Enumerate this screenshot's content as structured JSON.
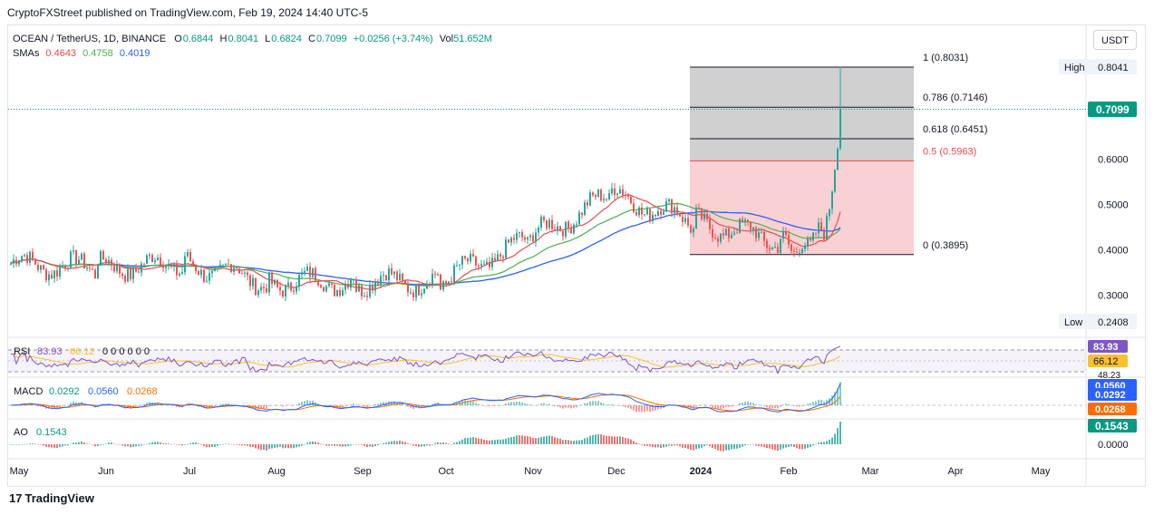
{
  "publisher": "CryptoFXStreet published on TradingView.com, Feb 19, 2024 14:40 UTC-5",
  "currency_button": "USDT",
  "legend": {
    "symbol": "OCEAN / TetherUS, 1D, BINANCE",
    "o_label": "O",
    "o": "0.6844",
    "h_label": "H",
    "h": "0.8041",
    "l_label": "L",
    "l": "0.6824",
    "c_label": "C",
    "c": "0.7099",
    "change": "+0.0256 (+3.74%)",
    "vol_label": "Vol",
    "vol": "51.652M",
    "smas_label": "SMAs",
    "sma1": "0.4643",
    "sma2": "0.4758",
    "sma3": "0.4019"
  },
  "price_axis": {
    "ticks": [
      "0.6000",
      "0.5000",
      "0.4000",
      "0.3000"
    ],
    "high_label": "High",
    "high_value": "0.8041",
    "low_label": "Low",
    "low_value": "0.2408",
    "last_price": "0.7099"
  },
  "fib_labels": [
    "1 (0.8031)",
    "0.786 (0.7146)",
    "0.618 (0.6451)",
    "0.5 (0.5963)",
    "0 (0.3895)"
  ],
  "x_ticks": [
    "May",
    "Jun",
    "Jul",
    "Aug",
    "Sep",
    "Oct",
    "Nov",
    "Dec",
    "2024",
    "Feb",
    "Mar",
    "Apr",
    "May"
  ],
  "rsi": {
    "label": "RSI",
    "v1": "83.93",
    "v2": "66.12",
    "dots": "0 0 0 0 0 0",
    "axis_values": [
      "83.93",
      "66.12",
      "48.23"
    ]
  },
  "macd": {
    "label": "MACD",
    "v1": "0.0292",
    "v2": "0.0560",
    "v3": "0.0268",
    "axis_values": [
      "0.0560",
      "0.0292",
      "0.0268"
    ]
  },
  "ao": {
    "label": "AO",
    "v1": "0.1543",
    "axis_values": [
      "0.1543",
      "0.0000"
    ]
  },
  "footer": {
    "logo": "17",
    "brand": "TradingView"
  },
  "colors": {
    "sma1": "#e84c4c",
    "sma2": "#4caf50",
    "sma3": "#2962ff",
    "up": "#26a69a",
    "down": "#ef5350",
    "rsi": "#7e57c2",
    "rsi_ma": "#fbc02d",
    "macd": "#2962ff",
    "signal": "#ff6d00",
    "fib_upper": "#c8c8c8",
    "fib_lower": "#f8c9cc"
  },
  "chart_data": {
    "type": "candlestick",
    "title": "OCEAN / TetherUS, 1D, BINANCE",
    "ylim": [
      0.24,
      0.85
    ],
    "grid": false,
    "monthly_closes": [
      {
        "x": "May",
        "y": 0.37
      },
      {
        "x": "Jun",
        "y": 0.36
      },
      {
        "x": "Jul",
        "y": 0.37
      },
      {
        "x": "Aug",
        "y": 0.33
      },
      {
        "x": "Sep",
        "y": 0.33
      },
      {
        "x": "Oct",
        "y": 0.33
      },
      {
        "x": "Nov",
        "y": 0.42
      },
      {
        "x": "Dec",
        "y": 0.52
      },
      {
        "x": "2024",
        "y": 0.46
      },
      {
        "x": "Feb",
        "y": 0.42
      },
      {
        "x": "Feb 19",
        "y": 0.7099
      }
    ],
    "fibonacci": [
      {
        "level": 1,
        "price": 0.8031
      },
      {
        "level": 0.786,
        "price": 0.7146
      },
      {
        "level": 0.618,
        "price": 0.6451
      },
      {
        "level": 0.5,
        "price": 0.5963
      },
      {
        "level": 0,
        "price": 0.3895
      }
    ],
    "high": 0.8041,
    "low": 0.2408,
    "last": 0.7099
  }
}
